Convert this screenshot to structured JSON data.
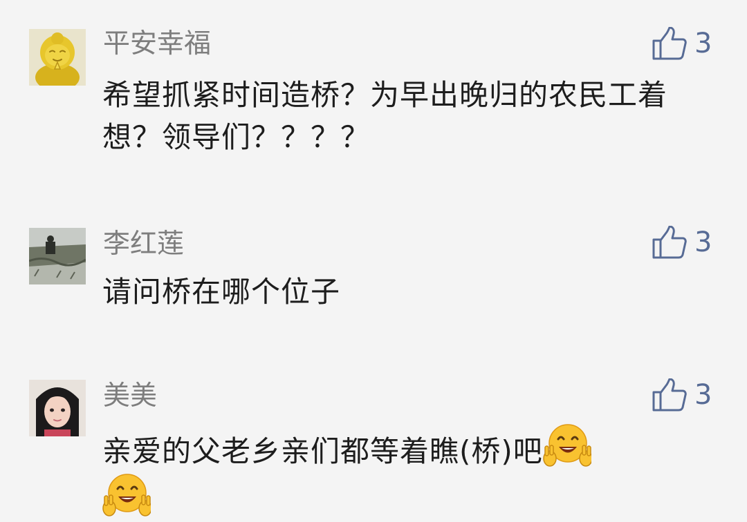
{
  "comments": [
    {
      "name": "平安幸福",
      "text": "希望抓紧时间造桥？为早出晚归的农民工着想？领导们？？？？",
      "likes": "3",
      "avatar": "golden-buddha-figurine-avatar",
      "emojis": []
    },
    {
      "name": "李红莲",
      "text": "请问桥在哪个位子",
      "likes": "3",
      "avatar": "riverside-photo-avatar",
      "emojis": []
    },
    {
      "name": "美美",
      "text": "亲爱的父老乡亲们都等着瞧(桥)吧",
      "likes": "3",
      "avatar": "girl-portrait-avatar",
      "emojis": [
        "smiling-peace-hands-emoji",
        "smiling-peace-hands-emoji"
      ]
    }
  ],
  "colors": {
    "background": "#f4f4f4",
    "name_text": "#7e7e7e",
    "body_text": "#1d1d1d",
    "like_accent": "#576b95"
  },
  "icons": {
    "like": "thumbs-up-outline-icon"
  }
}
